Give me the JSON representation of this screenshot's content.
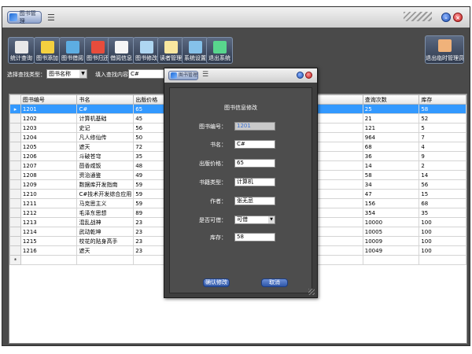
{
  "app": {
    "logo_text": "图书管理"
  },
  "toolbar": {
    "buttons": [
      {
        "label": "统计查询",
        "color": "#e8e8e8"
      },
      {
        "label": "图书添加",
        "color": "#f4d03f"
      },
      {
        "label": "图书借阅",
        "color": "#5dade2"
      },
      {
        "label": "图书归还",
        "color": "#e74c3c"
      },
      {
        "label": "借阅信息",
        "color": "#f5f5f5"
      },
      {
        "label": "图书修改",
        "color": "#aed6f1"
      },
      {
        "label": "读者管理",
        "color": "#f9e79f"
      },
      {
        "label": "系统设置",
        "color": "#85c1e9"
      },
      {
        "label": "退出系统",
        "color": "#58d68d"
      }
    ],
    "right_button": {
      "label": "退出临时管理员",
      "color": "#f0b27a"
    }
  },
  "filter": {
    "type_label": "选择查找类型：",
    "type_value": "图书名称",
    "keyword_label": "填入查找内容：",
    "keyword_value": "C#"
  },
  "grid": {
    "headers": [
      "图书编号",
      "书名",
      "出版价格",
      "",
      "",
      "查询次数",
      "库存"
    ],
    "rows": [
      [
        "1201",
        "C#",
        "65",
        "",
        "",
        "25",
        "58"
      ],
      [
        "1202",
        "计算机基础",
        "45",
        "",
        "",
        "21",
        "52"
      ],
      [
        "1203",
        "史记",
        "56",
        "",
        "",
        "121",
        "5"
      ],
      [
        "1204",
        "凡人修仙传",
        "50",
        "",
        "",
        "964",
        "7"
      ],
      [
        "1205",
        "遮天",
        "72",
        "",
        "",
        "68",
        "4"
      ],
      [
        "1206",
        "斗破苍穹",
        "35",
        "",
        "",
        "36",
        "9"
      ],
      [
        "1207",
        "茴香咸饭",
        "48",
        "",
        "",
        "14",
        "2"
      ],
      [
        "1208",
        "资治通鉴",
        "49",
        "",
        "",
        "58",
        "14"
      ],
      [
        "1209",
        "数据库开发指南",
        "59",
        "",
        "",
        "34",
        "56"
      ],
      [
        "1210",
        "C#技术开发综合应用",
        "59",
        "",
        "",
        "47",
        "15"
      ],
      [
        "1211",
        "马克思主义",
        "59",
        "",
        "",
        "156",
        "68"
      ],
      [
        "1212",
        "毛泽东思想",
        "89",
        "",
        "",
        "354",
        "35"
      ],
      [
        "1213",
        "混乱战神",
        "23",
        "",
        "",
        "10000",
        "100"
      ],
      [
        "1214",
        "武动乾坤",
        "23",
        "",
        "",
        "10005",
        "100"
      ],
      [
        "1215",
        "校花的贴身高手",
        "23",
        "",
        "",
        "10009",
        "100"
      ],
      [
        "1216",
        "遮天",
        "23",
        "",
        "",
        "10049",
        "100"
      ]
    ],
    "selected_row_index": 0,
    "new_row_marker": "*",
    "current_row_marker": "▸"
  },
  "dialog": {
    "logo_text": "图书管理",
    "heading": "图书信息修改",
    "fields": [
      {
        "label": "图书编号：",
        "value": "1201"
      },
      {
        "label": "书名：",
        "value": "C#"
      },
      {
        "label": "出版价格：",
        "value": "65"
      },
      {
        "label": "书籍类型：",
        "value": "计算机"
      },
      {
        "label": "作者：",
        "value": "张无忌"
      },
      {
        "label": "是否可借：",
        "value": "可借"
      },
      {
        "label": "库存：",
        "value": "58"
      }
    ],
    "confirm_label": "确认修改",
    "cancel_label": "取消"
  }
}
